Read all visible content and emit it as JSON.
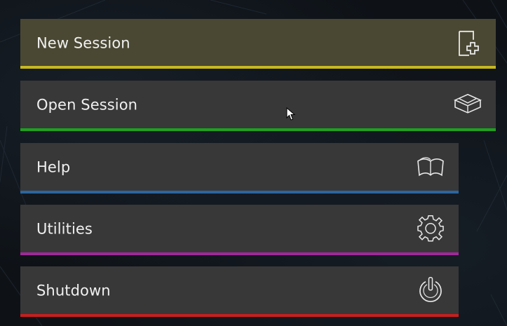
{
  "menu": {
    "items": [
      {
        "label": "New Session",
        "icon": "new-session-icon",
        "accent": "#c9b91a",
        "bg": "#4d4a35"
      },
      {
        "label": "Open Session",
        "icon": "open-box-icon",
        "accent": "#1fa01f",
        "bg": "#383838"
      },
      {
        "label": "Help",
        "icon": "book-icon",
        "accent": "#2c6aa0",
        "bg": "#383838"
      },
      {
        "label": "Utilities",
        "icon": "gear-icon",
        "accent": "#a02a98",
        "bg": "#383838"
      },
      {
        "label": "Shutdown",
        "icon": "power-icon",
        "accent": "#c82020",
        "bg": "#383838"
      }
    ]
  }
}
